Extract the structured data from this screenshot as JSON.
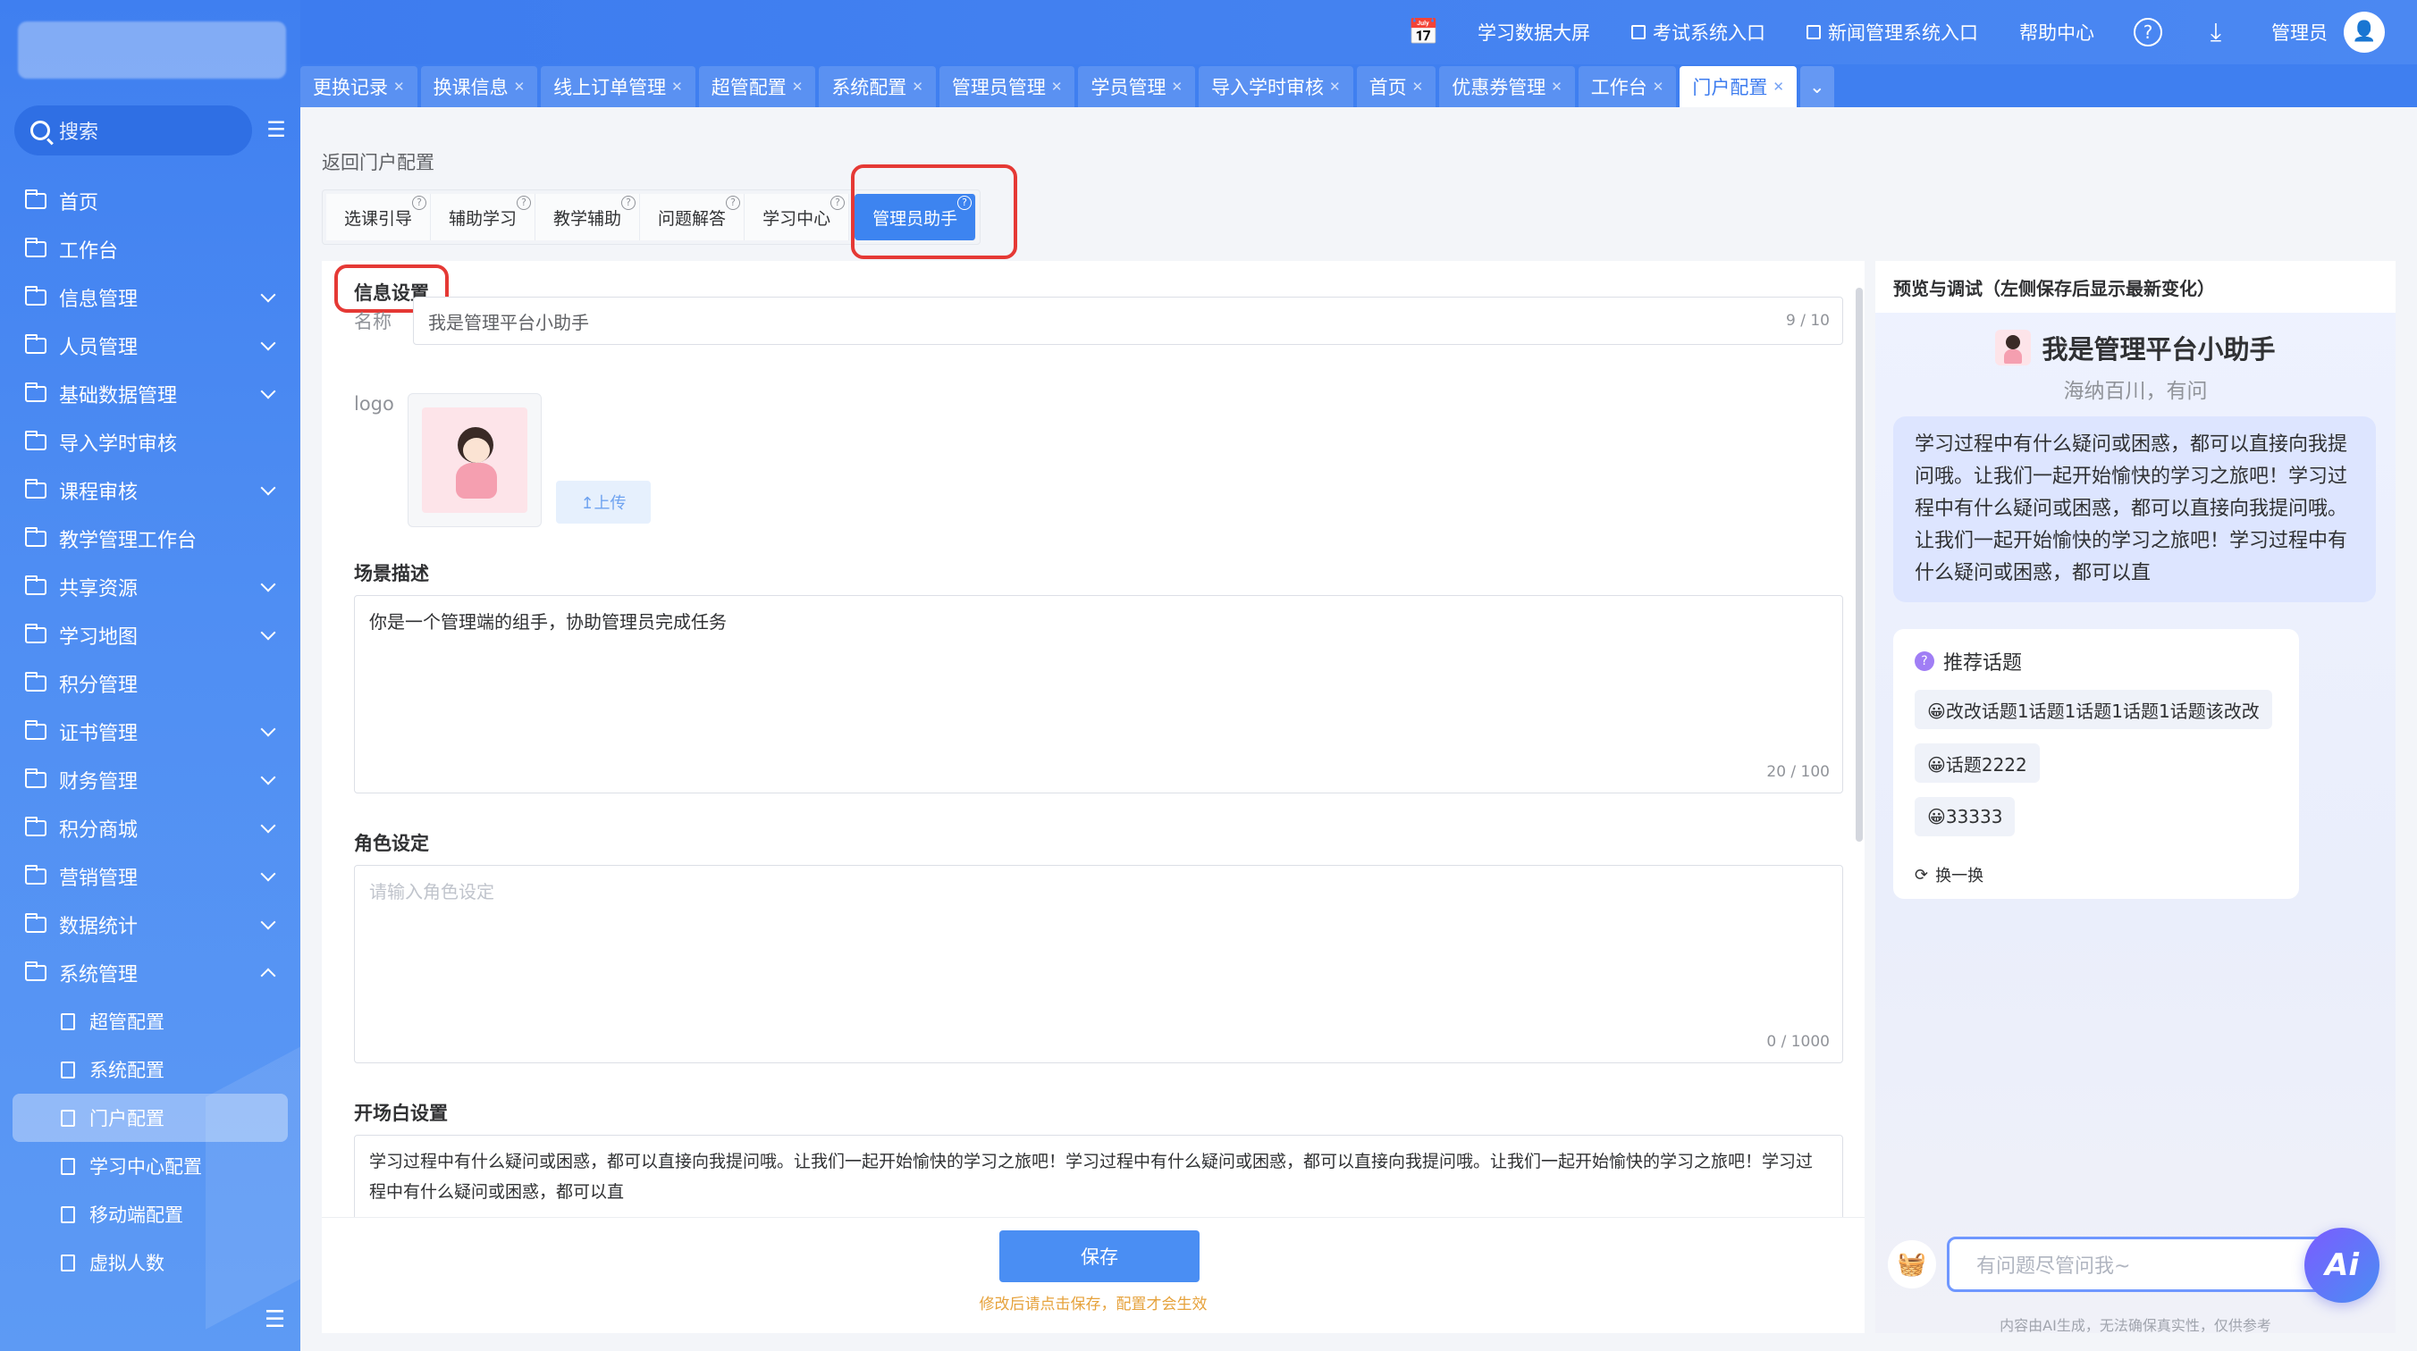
{
  "sidebar": {
    "search_label": "搜索",
    "items": [
      {
        "label": "首页",
        "chev": ""
      },
      {
        "label": "工作台",
        "chev": ""
      },
      {
        "label": "信息管理",
        "chev": "down"
      },
      {
        "label": "人员管理",
        "chev": "down"
      },
      {
        "label": "基础数据管理",
        "chev": "down"
      },
      {
        "label": "导入学时审核",
        "chev": ""
      },
      {
        "label": "课程审核",
        "chev": "down"
      },
      {
        "label": "教学管理工作台",
        "chev": ""
      },
      {
        "label": "共享资源",
        "chev": "down"
      },
      {
        "label": "学习地图",
        "chev": "down"
      },
      {
        "label": "积分管理",
        "chev": ""
      },
      {
        "label": "证书管理",
        "chev": "down"
      },
      {
        "label": "财务管理",
        "chev": "down"
      },
      {
        "label": "积分商城",
        "chev": "down"
      },
      {
        "label": "营销管理",
        "chev": "down"
      },
      {
        "label": "数据统计",
        "chev": "down"
      },
      {
        "label": "系统管理",
        "chev": "up"
      }
    ],
    "subitems": [
      {
        "label": "超管配置",
        "active": false
      },
      {
        "label": "系统配置",
        "active": false
      },
      {
        "label": "门户配置",
        "active": true
      },
      {
        "label": "学习中心配置",
        "active": false
      },
      {
        "label": "移动端配置",
        "active": false
      },
      {
        "label": "虚拟人数",
        "active": false
      }
    ]
  },
  "header": {
    "bigscreen": "学习数据大屏",
    "exam_entry": "考试系统入口",
    "news_entry": "新闻管理系统入口",
    "help": "帮助中心",
    "user": "管理员"
  },
  "tabs": [
    {
      "label": "更换记录",
      "active": false
    },
    {
      "label": "换课信息",
      "active": false
    },
    {
      "label": "线上订单管理",
      "active": false
    },
    {
      "label": "超管配置",
      "active": false
    },
    {
      "label": "系统配置",
      "active": false
    },
    {
      "label": "管理员管理",
      "active": false
    },
    {
      "label": "学员管理",
      "active": false
    },
    {
      "label": "导入学时审核",
      "active": false
    },
    {
      "label": "首页",
      "active": false
    },
    {
      "label": "优惠券管理",
      "active": false
    },
    {
      "label": "工作台",
      "active": false
    },
    {
      "label": "门户配置",
      "active": true
    }
  ],
  "page": {
    "back": "返回门户配置",
    "subtabs": [
      {
        "label": "选课引导",
        "active": false
      },
      {
        "label": "辅助学习",
        "active": false
      },
      {
        "label": "教学辅助",
        "active": false
      },
      {
        "label": "问题解答",
        "active": false
      },
      {
        "label": "学习中心",
        "active": false
      },
      {
        "label": "管理员助手",
        "active": true
      }
    ]
  },
  "form": {
    "section_info": "信息设置",
    "name_label": "名称",
    "name_value": "我是管理平台小助手",
    "name_count": "9 / 10",
    "logo_label": "logo",
    "upload_label": "↥上传",
    "scene_label": "场景描述",
    "scene_value": "你是一个管理端的组手，协助管理员完成任务",
    "scene_count": "20 / 100",
    "role_label": "角色设定",
    "role_placeholder": "请输入角色设定",
    "role_count": "0 / 1000",
    "opening_label": "开场白设置",
    "opening_value": "学习过程中有什么疑问或困惑，都可以直接向我提问哦。让我们一起开始愉快的学习之旅吧！学习过程中有什么疑问或困惑，都可以直接向我提问哦。让我们一起开始愉快的学习之旅吧！学习过程中有什么疑问或困惑，都可以直",
    "save": "保存",
    "save_tip": "修改后请点击保存，配置才会生效"
  },
  "preview": {
    "title": "预览与调试（左侧保存后显示最新变化）",
    "name": "我是管理平台小助手",
    "subtitle": "海纳百川，有问",
    "greeting": "学习过程中有什么疑问或困惑，都可以直接向我提问哦。让我们一起开始愉快的学习之旅吧！学习过程中有什么疑问或困惑，都可以直接向我提问哦。让我们一起开始愉快的学习之旅吧！学习过程中有什么疑问或困惑，都可以直",
    "topics_title": "推荐话题",
    "topics": [
      "😀改改话题1话题1话题1话题1话题该改改",
      "😀话题2222",
      "😀33333"
    ],
    "swap": "换一换",
    "input_placeholder": "有问题尽管问我~",
    "ai_label": "Ai",
    "disclaimer": "内容由AI生成，无法确保真实性，仅供参考"
  }
}
